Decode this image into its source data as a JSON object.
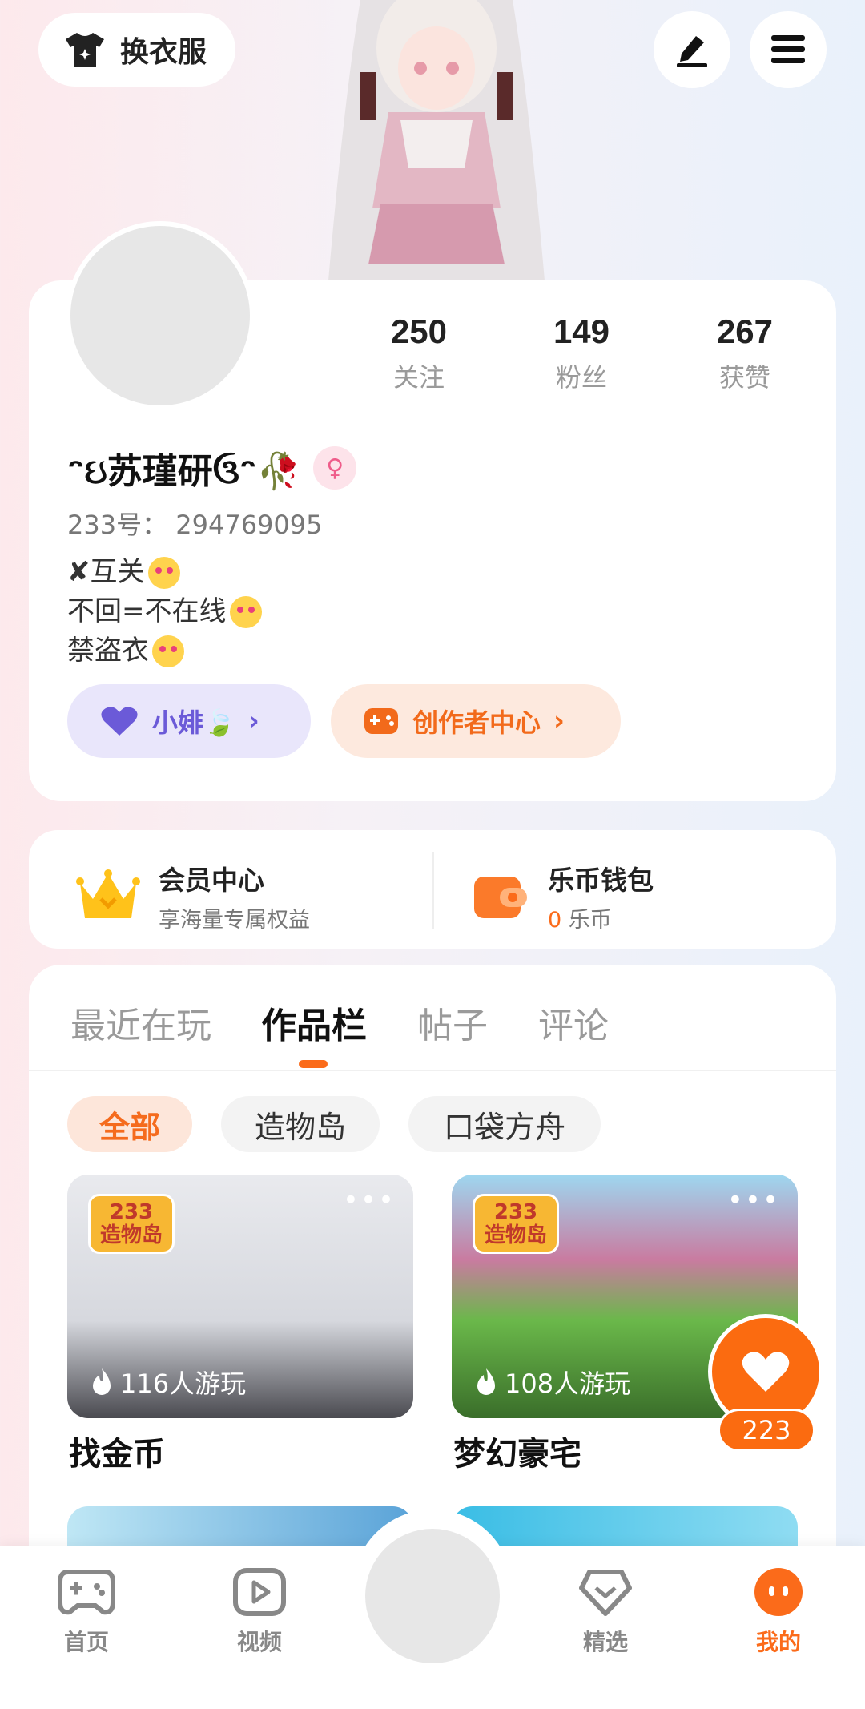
{
  "header": {
    "outfit_label": "换衣服"
  },
  "profile": {
    "stats": [
      {
        "value": "250",
        "label": "关注"
      },
      {
        "value": "149",
        "label": "粉丝"
      },
      {
        "value": "267",
        "label": "获赞"
      }
    ],
    "nickname": "ᵔઇ苏瑾研ઉᵔ🥀",
    "gender_symbol": "♀",
    "uid": "233号： 294769095",
    "bio": [
      "✘互关",
      "不回=不在线",
      "禁盗衣"
    ],
    "companion_label": "小婔🍃",
    "creator_center_label": "创作者中心"
  },
  "member": {
    "vip_title": "会员中心",
    "vip_sub": "享海量专属权益",
    "wallet_title": "乐币钱包",
    "wallet_amount": "0",
    "wallet_unit": "乐币"
  },
  "tabs": [
    "最近在玩",
    "作品栏",
    "帖子",
    "评论"
  ],
  "chips": [
    "全部",
    "造物岛",
    "口袋方舟"
  ],
  "works": [
    {
      "badge_top": "233",
      "badge_bottom": "造物岛",
      "plays": "116人游玩",
      "title": "找金币"
    },
    {
      "badge_top": "233",
      "badge_bottom": "造物岛",
      "plays": "108人游玩",
      "title": "梦幻豪宅"
    }
  ],
  "like_count": "223",
  "nav": [
    "首页",
    "视频",
    "精选",
    "我的"
  ],
  "colors": {
    "accent": "#fb6b1a",
    "purple": "#6b5ad8"
  }
}
